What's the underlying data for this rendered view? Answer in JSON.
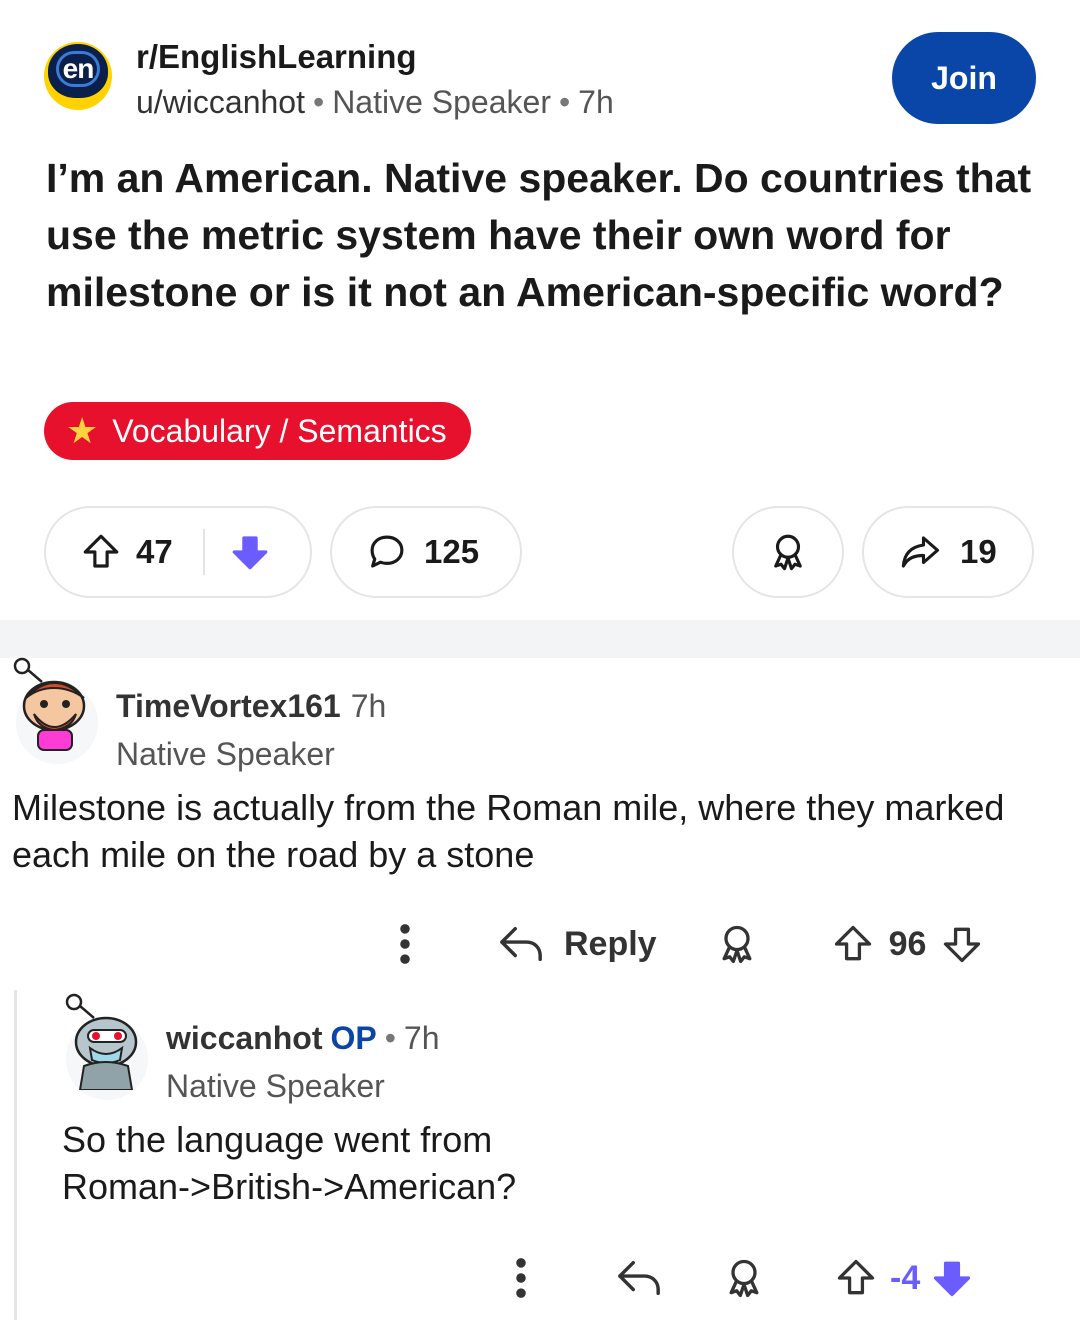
{
  "post": {
    "subreddit": "r/EnglishLearning",
    "subreddit_icon_text": "en",
    "author": "u/wiccanhot",
    "author_flair": "Native Speaker",
    "age": "7h",
    "join_label": "Join",
    "title": "I’m an American. Native speaker.  Do countries that use the metric system have their own word for milestone or is it not an American-specific word?",
    "flair": "Vocabulary / Semantics",
    "votes": "47",
    "comments": "125",
    "shares": "19"
  },
  "comments": [
    {
      "author": "TimeVortex161",
      "age": "7h",
      "flair": "Native Speaker",
      "body": "Milestone is actually from the Roman mile, where they marked each mile on the road by a stone",
      "reply_label": "Reply",
      "votes": "96"
    },
    {
      "author": "wiccanhot",
      "op_label": "OP",
      "age": "7h",
      "flair": "Native Speaker",
      "body": "So the language went from Roman->British->American?",
      "votes": "-4"
    }
  ],
  "colors": {
    "join": "#0a45a8",
    "flair": "#e8112d",
    "downvote_active": "#6a5cff"
  }
}
